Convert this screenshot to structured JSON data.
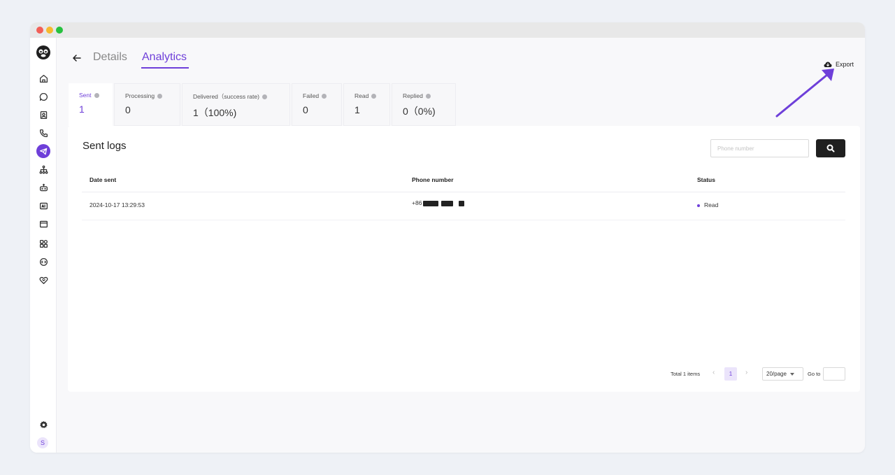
{
  "nav": {
    "back_label": "←",
    "tabs": [
      {
        "label": "Details",
        "active": false
      },
      {
        "label": "Analytics",
        "active": true
      }
    ]
  },
  "export": {
    "label": "Export",
    "icon": "cloud-download-icon"
  },
  "stats": [
    {
      "label": "Sent",
      "value": "1",
      "active": true
    },
    {
      "label": "Processing",
      "value": "0",
      "active": false
    },
    {
      "label": "Delivered（success rate)",
      "value": "1（100%)",
      "active": false
    },
    {
      "label": "Failed",
      "value": "0",
      "active": false
    },
    {
      "label": "Read",
      "value": "1",
      "active": false
    },
    {
      "label": "Replied",
      "value": "0（0%)",
      "active": false
    }
  ],
  "panel": {
    "title": "Sent logs",
    "search_placeholder": "Phone number",
    "search_icon": "search-icon"
  },
  "table": {
    "columns": [
      "Date sent",
      "Phone number",
      "Status"
    ],
    "rows": [
      {
        "date_sent": "2024-10-17 13:29:53",
        "phone": "+86",
        "status": "Read"
      }
    ]
  },
  "pagination": {
    "total": "Total 1 items",
    "current_page": "1",
    "page_size": "20/page",
    "goto_label": "Go to"
  },
  "sidebar": {
    "avatar_initial": "S",
    "icons": [
      "home-icon",
      "chat-icon",
      "contacts-icon",
      "phone-icon",
      "broadcast-icon",
      "flow-icon",
      "bot-icon",
      "ai-icon",
      "template-icon",
      "apps-icon",
      "integration-icon",
      "partner-icon",
      "settings-icon"
    ]
  },
  "colors": {
    "accent": "#6e3fd9",
    "dark": "#1f1f1f"
  }
}
